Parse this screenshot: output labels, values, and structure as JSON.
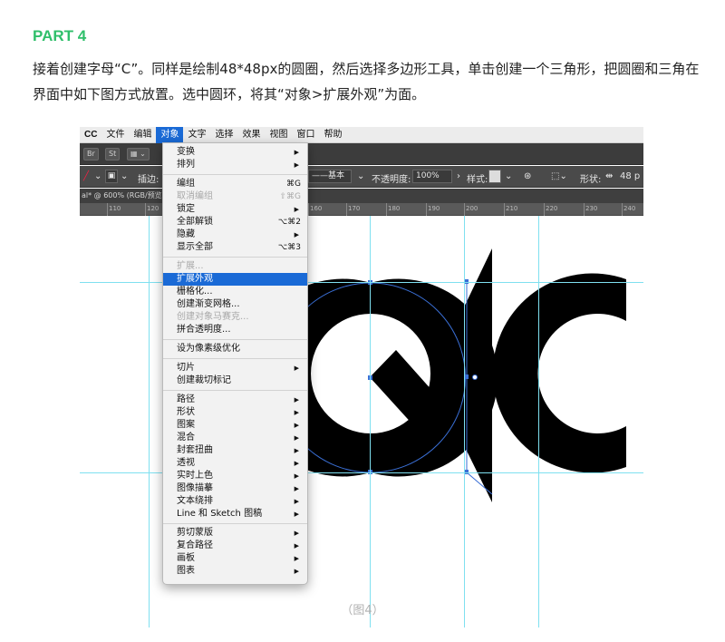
{
  "heading": "PART 4",
  "paragraph": "接着创建字母“C”。同样是绘制48*48px的圆圈，然后选择多边形工具，单击创建一个三角形，把圆圈和三角在界面中如下图方式放置。选中圆环，将其“对象>扩展外观”为面。",
  "menubar": {
    "app": "CC",
    "items": [
      "文件",
      "编辑",
      "对象",
      "文字",
      "选择",
      "效果",
      "视图",
      "窗口",
      "帮助"
    ],
    "active": "对象"
  },
  "apptoolbar": {
    "br": "Br",
    "st": "St"
  },
  "controlbar": {
    "interp_label": "插边:",
    "stroke_style": "基本",
    "opacity_label": "不透明度:",
    "opacity_value": "100%",
    "style_label": "样式:",
    "shape_label": "形状:",
    "shape_value": "48 p"
  },
  "doctab": "al* @ 600% (RGB/预览)",
  "ruler_ticks": [
    "110",
    "120",
    "160",
    "170",
    "180",
    "190",
    "200",
    "210",
    "220",
    "230",
    "240"
  ],
  "menu": {
    "groups": [
      [
        {
          "label": "变换",
          "submenu": true
        },
        {
          "label": "排列",
          "submenu": true
        }
      ],
      [
        {
          "label": "编组",
          "shortcut": "⌘G"
        },
        {
          "label": "取消编组",
          "shortcut": "⇧⌘G",
          "disabled": true
        },
        {
          "label": "锁定",
          "submenu": true
        },
        {
          "label": "全部解锁",
          "shortcut": "⌥⌘2"
        },
        {
          "label": "隐藏",
          "submenu": true
        },
        {
          "label": "显示全部",
          "shortcut": "⌥⌘3"
        }
      ],
      [
        {
          "label": "扩展...",
          "disabled": true
        },
        {
          "label": "扩展外观",
          "highlighted": true
        },
        {
          "label": "栅格化..."
        },
        {
          "label": "创建渐变网格..."
        },
        {
          "label": "创建对象马赛克...",
          "disabled": true
        },
        {
          "label": "拼合透明度..."
        }
      ],
      [
        {
          "label": "设为像素级优化"
        }
      ],
      [
        {
          "label": "切片",
          "submenu": true
        },
        {
          "label": "创建裁切标记"
        }
      ],
      [
        {
          "label": "路径",
          "submenu": true
        },
        {
          "label": "形状",
          "submenu": true
        },
        {
          "label": "图案",
          "submenu": true
        },
        {
          "label": "混合",
          "submenu": true
        },
        {
          "label": "封套扭曲",
          "submenu": true
        },
        {
          "label": "透视",
          "submenu": true
        },
        {
          "label": "实时上色",
          "submenu": true
        },
        {
          "label": "图像描摹",
          "submenu": true
        },
        {
          "label": "文本绕排",
          "submenu": true
        },
        {
          "label": "Line 和 Sketch 图稿",
          "submenu": true
        }
      ],
      [
        {
          "label": "剪切蒙版",
          "submenu": true
        },
        {
          "label": "复合路径",
          "submenu": true
        },
        {
          "label": "画板",
          "submenu": true
        },
        {
          "label": "图表",
          "submenu": true
        }
      ]
    ]
  },
  "caption": "（图4）",
  "colors": {
    "accent": "#2fbf6a",
    "highlight": "#1a6ad6",
    "guide": "#7fe0f0",
    "selection": "#3a6fd6"
  }
}
